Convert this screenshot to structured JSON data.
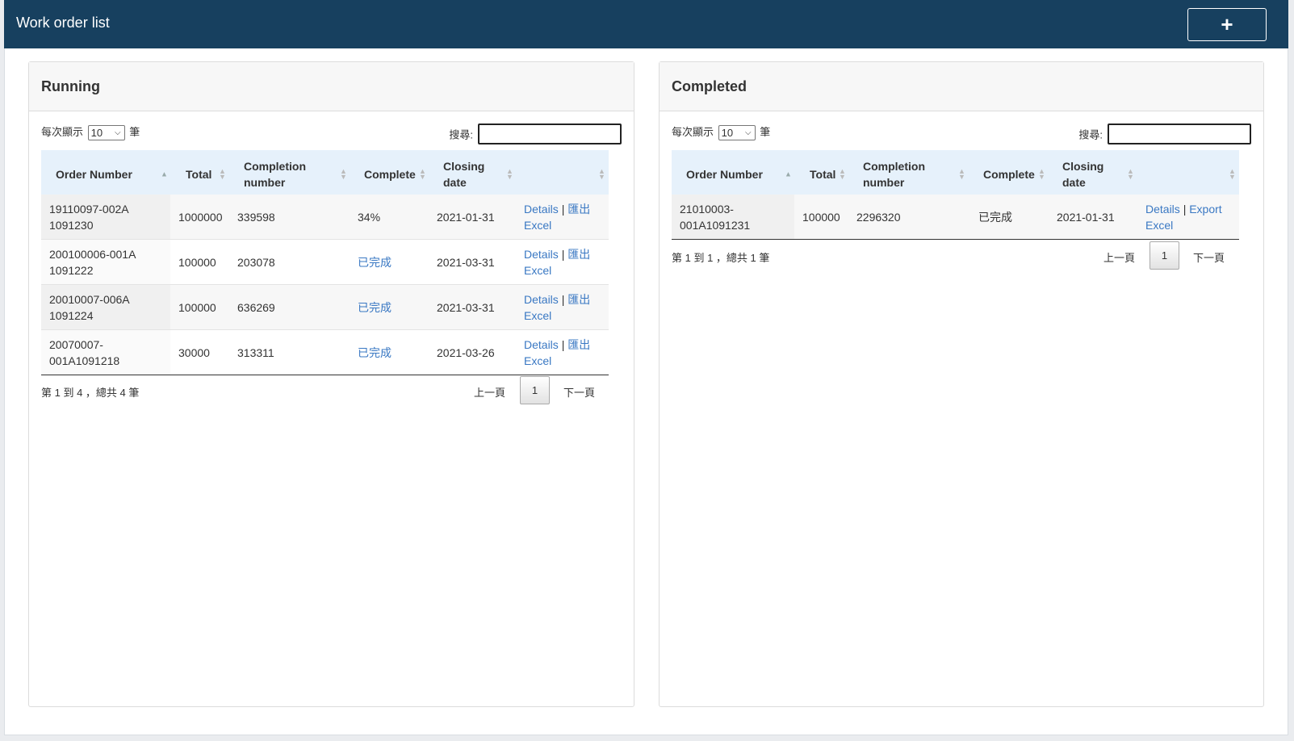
{
  "header": {
    "title": "Work order list",
    "add_label": "+"
  },
  "running": {
    "title": "Running",
    "length_prefix": "每次顯示",
    "length_value": "10",
    "length_suffix": "筆",
    "search_label": "搜尋:",
    "search_value": "",
    "columns": [
      "Order Number",
      "Total",
      "Completion number",
      "Complete",
      "Closing date",
      ""
    ],
    "rows": [
      {
        "order": "19110097-002A 1091230",
        "total": "1000000",
        "completion": "339598",
        "complete": "34%",
        "date": "2021-01-31",
        "details": "Details",
        "sep": "|",
        "export": "匯出",
        "excel": "Excel"
      },
      {
        "order": "200100006-001A 1091222",
        "total": "100000",
        "completion": "203078",
        "complete": "已完成",
        "date": "2021-03-31",
        "details": "Details",
        "sep": "|",
        "export": "匯出",
        "excel": "Excel"
      },
      {
        "order": "20010007-006A 1091224",
        "total": "100000",
        "completion": "636269",
        "complete": "已完成",
        "date": "2021-03-31",
        "details": "Details",
        "sep": "|",
        "export": "匯出",
        "excel": "Excel"
      },
      {
        "order": "20070007- 001A1091218",
        "total": "30000",
        "completion": "313311",
        "complete": "已完成",
        "date": "2021-03-26",
        "details": "Details",
        "sep": "|",
        "export": "匯出",
        "excel": "Excel"
      }
    ],
    "info": "第 1 到 4 ，總共 4 筆",
    "prev": "上一頁",
    "page": "1",
    "next": "下一頁"
  },
  "completed": {
    "title": "Completed",
    "length_prefix": "每次顯示",
    "length_value": "10",
    "length_suffix": "筆",
    "search_label": "搜尋:",
    "search_value": "",
    "columns": [
      "Order Number",
      "Total",
      "Completion number",
      "Complete",
      "Closing date",
      ""
    ],
    "rows": [
      {
        "order": "21010003- 001A1091231",
        "total": "100000",
        "completion": "2296320",
        "complete": "已完成",
        "date": "2021-01-31",
        "details": "Details",
        "sep": "|",
        "export": "Export",
        "excel": "Excel"
      }
    ],
    "info": "第 1 到 1 ，總共 1 筆",
    "prev": "上一頁",
    "page": "1",
    "next": "下一頁"
  },
  "colors": {
    "header_bg": "#17405f",
    "link": "#3a78c3",
    "thead_bg": "#e6f1fb"
  }
}
